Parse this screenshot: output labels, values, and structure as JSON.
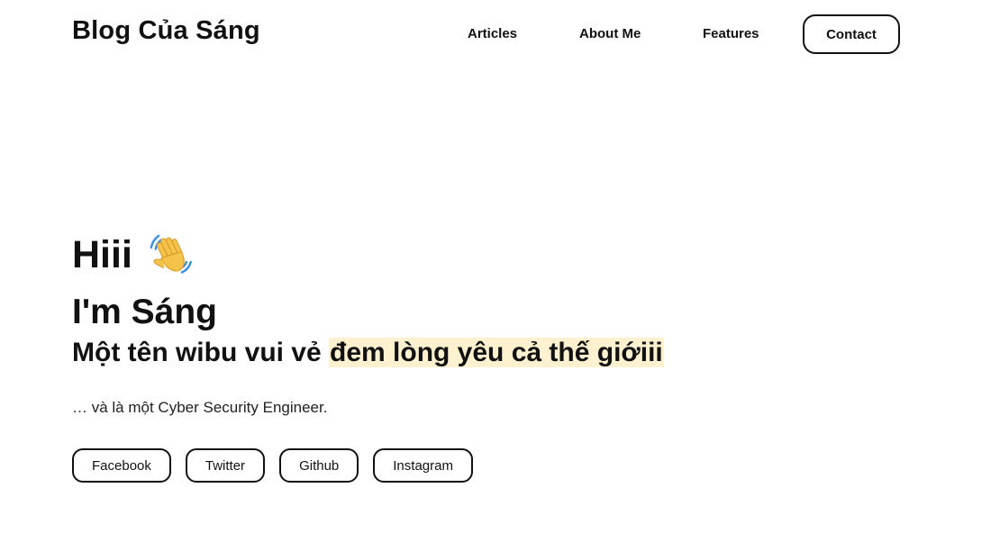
{
  "header": {
    "brand": "Blog Của Sáng",
    "nav": {
      "articles": "Articles",
      "about": "About Me",
      "features": "Features",
      "contact": "Contact"
    }
  },
  "hero": {
    "greeting": "Hiii",
    "greeting_icon": "waving-hand-icon",
    "name": "I'm Sáng",
    "tagline_plain": "Một tên wibu vui vẻ ",
    "tagline_highlight": "đem lòng yêu cả thế giớiii",
    "subtitle": "… và là một Cyber Security Engineer.",
    "highlight_color": "#fdf1cf"
  },
  "socials": {
    "facebook": "Facebook",
    "twitter": "Twitter",
    "github": "Github",
    "instagram": "Instagram"
  }
}
